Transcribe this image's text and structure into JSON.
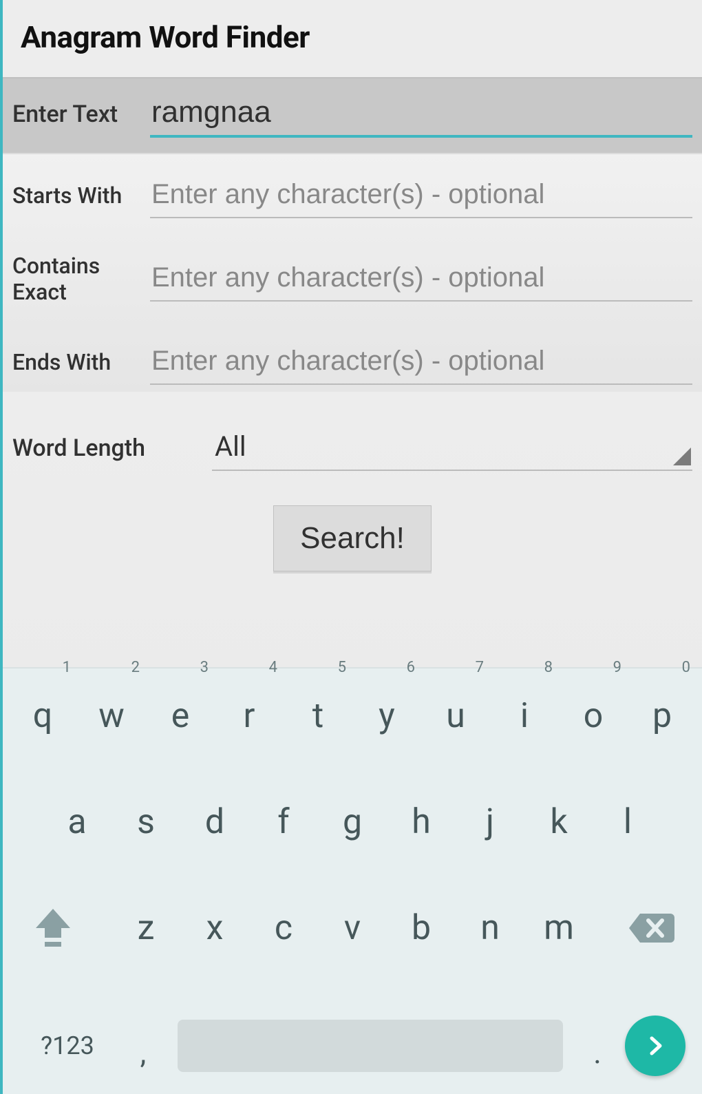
{
  "header": {
    "title": "Anagram Word Finder"
  },
  "main": {
    "enter_text_label": "Enter Text",
    "enter_text_value": "ramgnaa"
  },
  "filters": {
    "starts_with_label": "Starts With",
    "starts_with_placeholder": "Enter any character(s) - optional",
    "contains_exact_label": "Contains\nExact",
    "contains_exact_placeholder": "Enter any character(s) - optional",
    "ends_with_label": "Ends With",
    "ends_with_placeholder": "Enter any character(s) - optional"
  },
  "length": {
    "label": "Word Length",
    "value": "All"
  },
  "buttons": {
    "search": "Search!"
  },
  "keyboard": {
    "row1": [
      {
        "k": "q",
        "n": "1"
      },
      {
        "k": "w",
        "n": "2"
      },
      {
        "k": "e",
        "n": "3"
      },
      {
        "k": "r",
        "n": "4"
      },
      {
        "k": "t",
        "n": "5"
      },
      {
        "k": "y",
        "n": "6"
      },
      {
        "k": "u",
        "n": "7"
      },
      {
        "k": "i",
        "n": "8"
      },
      {
        "k": "o",
        "n": "9"
      },
      {
        "k": "p",
        "n": "0"
      }
    ],
    "row2": [
      "a",
      "s",
      "d",
      "f",
      "g",
      "h",
      "j",
      "k",
      "l"
    ],
    "row3": [
      "z",
      "x",
      "c",
      "v",
      "b",
      "n",
      "m"
    ],
    "sym": "?123",
    "comma": ",",
    "period": "."
  }
}
